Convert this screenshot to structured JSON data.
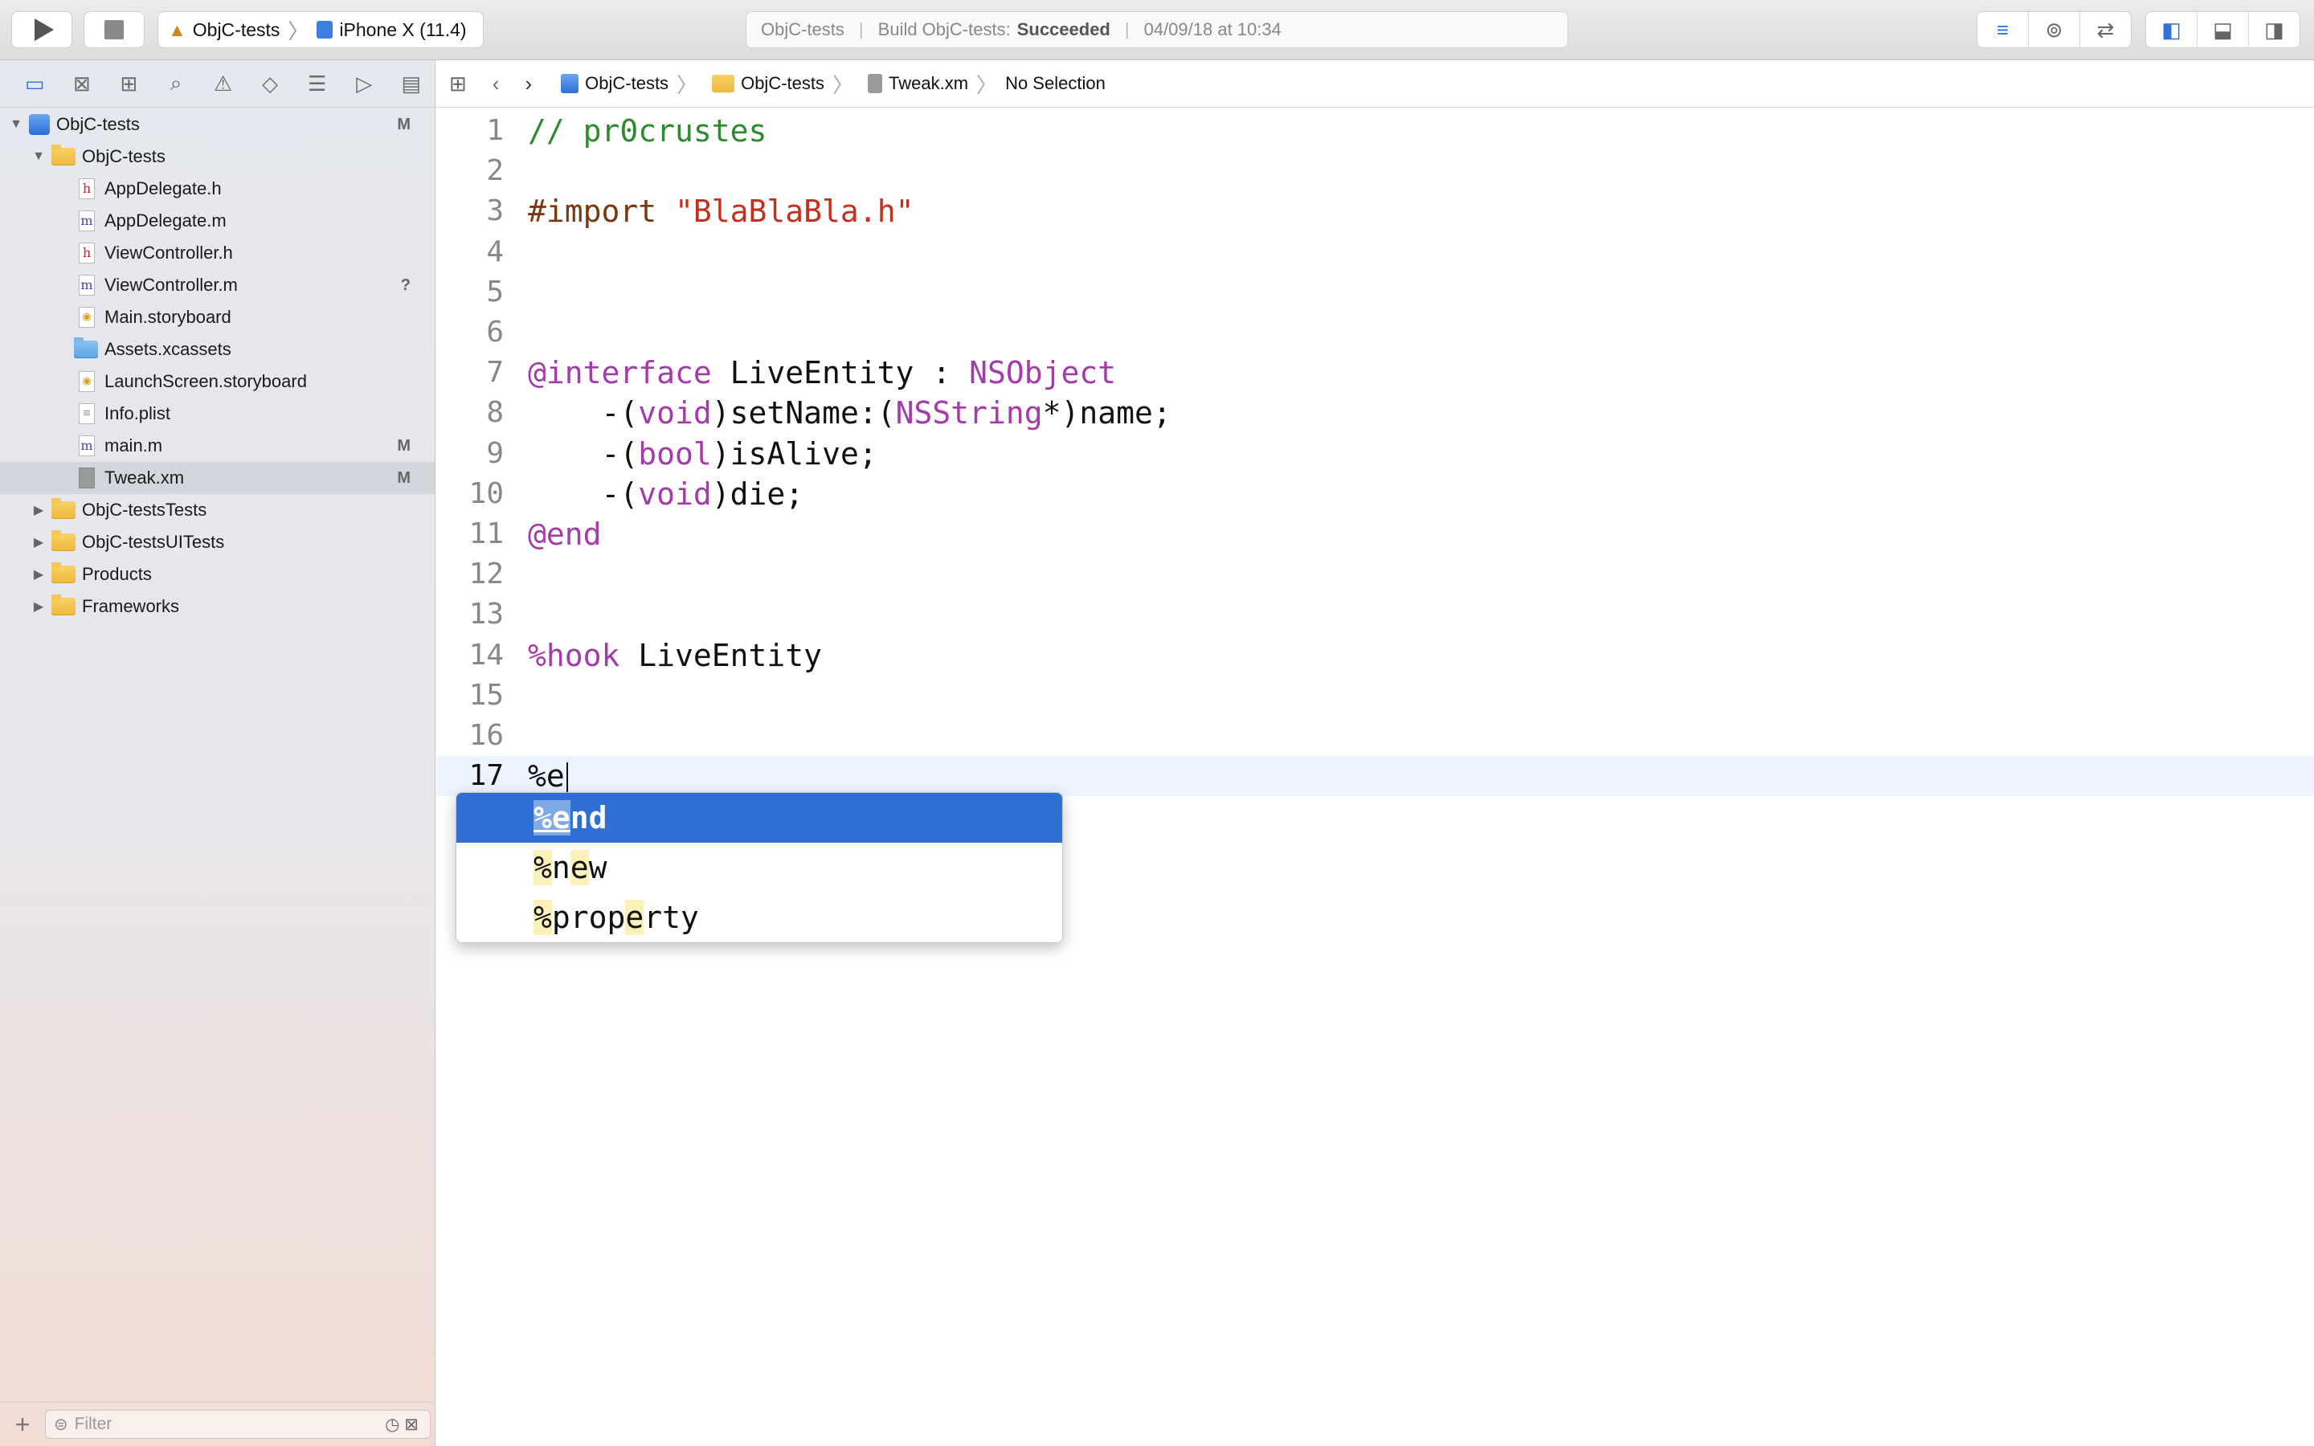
{
  "toolbar": {
    "scheme_name": "ObjC-tests",
    "destination": "iPhone X (11.4)",
    "activity_project": "ObjC-tests",
    "activity_status_prefix": "Build ObjC-tests:",
    "activity_status": "Succeeded",
    "activity_time": "04/09/18 at 10:34"
  },
  "navigator": {
    "root": {
      "name": "ObjC-tests",
      "badge": "M"
    },
    "items": [
      {
        "name": "ObjC-tests",
        "kind": "folder"
      },
      {
        "name": "AppDelegate.h",
        "kind": "h",
        "badge": ""
      },
      {
        "name": "AppDelegate.m",
        "kind": "m",
        "badge": ""
      },
      {
        "name": "ViewController.h",
        "kind": "h",
        "badge": ""
      },
      {
        "name": "ViewController.m",
        "kind": "m",
        "badge": "?"
      },
      {
        "name": "Main.storyboard",
        "kind": "storyboard",
        "badge": ""
      },
      {
        "name": "Assets.xcassets",
        "kind": "assets",
        "badge": ""
      },
      {
        "name": "LaunchScreen.storyboard",
        "kind": "storyboard",
        "badge": ""
      },
      {
        "name": "Info.plist",
        "kind": "plist",
        "badge": ""
      },
      {
        "name": "main.m",
        "kind": "m",
        "badge": "M"
      },
      {
        "name": "Tweak.xm",
        "kind": "xm",
        "badge": "M",
        "selected": true
      },
      {
        "name": "ObjC-testsTests",
        "kind": "folder"
      },
      {
        "name": "ObjC-testsUITests",
        "kind": "folder"
      },
      {
        "name": "Products",
        "kind": "folder"
      },
      {
        "name": "Frameworks",
        "kind": "folder"
      }
    ],
    "filter_placeholder": "Filter"
  },
  "jumpbar": {
    "crumbs": [
      "ObjC-tests",
      "ObjC-tests",
      "Tweak.xm",
      "No Selection"
    ]
  },
  "editor": {
    "lines": [
      {
        "n": "1",
        "html": "<span class='cmt'>// pr0crustes</span>"
      },
      {
        "n": "2",
        "html": ""
      },
      {
        "n": "3",
        "html": "<span class='pre'>#import </span><span class='str'>\"BlaBlaBla.h\"</span>"
      },
      {
        "n": "4",
        "html": ""
      },
      {
        "n": "5",
        "html": ""
      },
      {
        "n": "6",
        "html": ""
      },
      {
        "n": "7",
        "html": "<span class='kw'>@interface</span> LiveEntity : <span class='ty'>NSObject</span>"
      },
      {
        "n": "8",
        "html": "    -(<span class='kw'>void</span>)setName:(<span class='ty'>NSString</span>*)name;"
      },
      {
        "n": "9",
        "html": "    -(<span class='kw'>bool</span>)isAlive;"
      },
      {
        "n": "10",
        "html": "    -(<span class='kw'>void</span>)die;"
      },
      {
        "n": "11",
        "html": "<span class='kw'>@end</span>"
      },
      {
        "n": "12",
        "html": ""
      },
      {
        "n": "13",
        "html": ""
      },
      {
        "n": "14",
        "html": "<span class='kw'>%hook</span> LiveEntity"
      },
      {
        "n": "15",
        "html": ""
      },
      {
        "n": "16",
        "html": ""
      },
      {
        "n": "17",
        "html": "%e<span class='caret'></span>",
        "current": true
      }
    ]
  },
  "completion": {
    "items": [
      {
        "label": "%end",
        "selected": true
      },
      {
        "label": "%new",
        "selected": false
      },
      {
        "label": "%property",
        "selected": false
      }
    ]
  }
}
